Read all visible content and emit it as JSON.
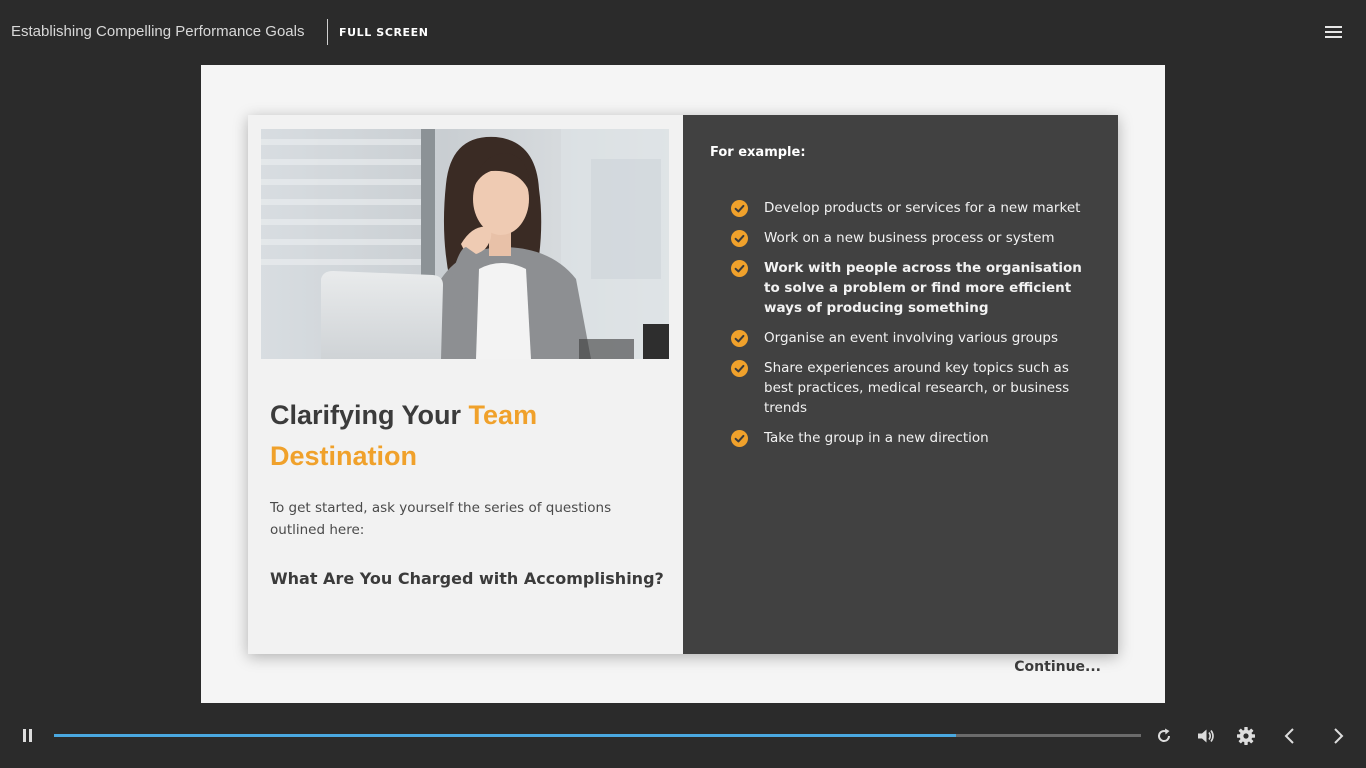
{
  "topbar": {
    "course_title": "Establishing Compelling Performance Goals",
    "fullscreen_label": "FULL SCREEN",
    "menu_icon": "hamburger-menu-icon"
  },
  "slide": {
    "heading_part1": "Clarifying Your ",
    "heading_accent": "Team Destination",
    "intro": "To get started, ask yourself the series of questions outlined here:",
    "subheading": "What Are You Charged with Accomplishing?",
    "example_label": "For example:",
    "examples": [
      "Develop products or services for a new market",
      "Work on a new business process or system",
      "Work with people across the organisation to solve a problem or find more efficient ways of producing something",
      "Organise an event involving various groups",
      "Share experiences around key topics such as best practices, medical research, or business trends",
      "Take the group in a new direction"
    ],
    "continue_label": "Continue..."
  },
  "player": {
    "progress": 0.83,
    "icons": [
      "pause-icon",
      "replay-icon",
      "volume-icon",
      "settings-icon",
      "previous-icon",
      "next-icon"
    ]
  },
  "colors": {
    "background": "#2b2b2b",
    "accent": "#f0a12b",
    "panel_dark": "#414141",
    "progress": "#4aa8e0"
  }
}
